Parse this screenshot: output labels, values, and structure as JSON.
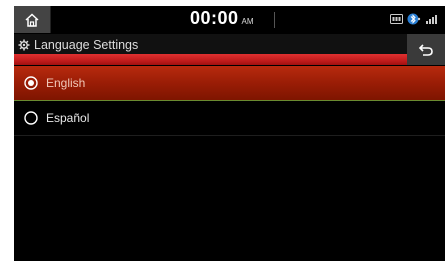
{
  "status_bar": {
    "time": "00:00",
    "ampm": "AM"
  },
  "header": {
    "title": "Language Settings"
  },
  "languages": [
    {
      "label": "English",
      "selected": true
    },
    {
      "label": "Español",
      "selected": false
    }
  ],
  "colors": {
    "selected_row": "#9a1d06",
    "title_accent": "#c21c1c",
    "background": "#000000",
    "status_icon_blue": "#2a7fd4"
  },
  "icons": {
    "home": "home-icon",
    "settings": "gear-icon",
    "back": "back-arrow-icon",
    "media": "media-icon",
    "bluetooth": "bluetooth-icon",
    "signal": "signal-icon"
  }
}
